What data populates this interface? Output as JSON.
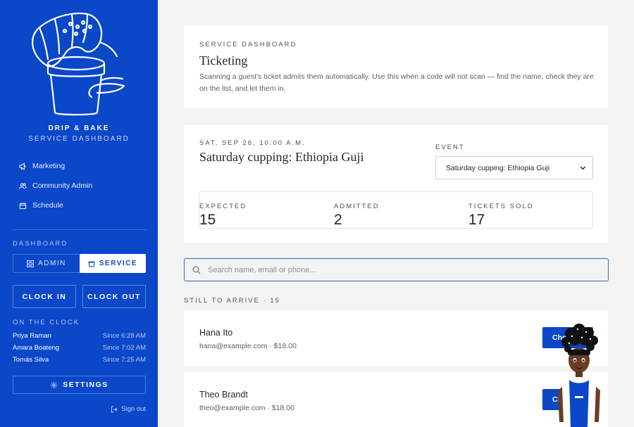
{
  "sidebar": {
    "brand_title": "DRIP & BAKE",
    "brand_subtitle": "SERVICE DASHBOARD",
    "nav": [
      {
        "label": "Marketing",
        "icon": "megaphone-icon"
      },
      {
        "label": "Community Admin",
        "icon": "users-icon"
      },
      {
        "label": "Schedule",
        "icon": "calendar-icon"
      }
    ],
    "dashboard_label": "DASHBOARD",
    "mode_toggle": {
      "admin_label": "ADMIN",
      "service_label": "SERVICE",
      "selected": "service"
    },
    "clock_in_label": "CLOCK IN",
    "clock_out_label": "CLOCK OUT",
    "on_the_clock_label": "ON THE CLOCK",
    "on_the_clock": [
      {
        "name": "Priya Raman",
        "since": "Since 6:28 AM"
      },
      {
        "name": "Amara Boateng",
        "since": "Since 7:02 AM"
      },
      {
        "name": "Tomás Silva",
        "since": "Since 7:25 AM"
      }
    ],
    "settings_label": "SETTINGS",
    "sign_out_label": "Sign out"
  },
  "intro": {
    "eyebrow": "SERVICE DASHBOARD",
    "title": "Ticketing",
    "description": "Scanning a guest's ticket admits them automatically. Use this when a code will not scan — find the name, check they are on the list, and let them in."
  },
  "event": {
    "date": "SAT, SEP 26, 10:00 A.M.",
    "title": "Saturday cupping: Ethiopia Guji",
    "select_label": "EVENT",
    "selected_event": "Saturday cupping: Ethiopia Guji",
    "stats": [
      {
        "label": "EXPECTED",
        "value": "15"
      },
      {
        "label": "ADMITTED",
        "value": "2"
      },
      {
        "label": "TICKETS SOLD",
        "value": "17"
      }
    ]
  },
  "search": {
    "placeholder": "Search name, email or phone..."
  },
  "list": {
    "label": "STILL TO ARRIVE · 15",
    "guests": [
      {
        "name": "Hana Ito",
        "meta": "hana@example.com · $18.00",
        "button": "Check in"
      },
      {
        "name": "Theo Brandt",
        "meta": "theo@example.com · $18.00",
        "button": "Check in"
      }
    ]
  },
  "colors": {
    "brand_blue": "#0a47c9",
    "page_bg": "#f3f3f3"
  }
}
